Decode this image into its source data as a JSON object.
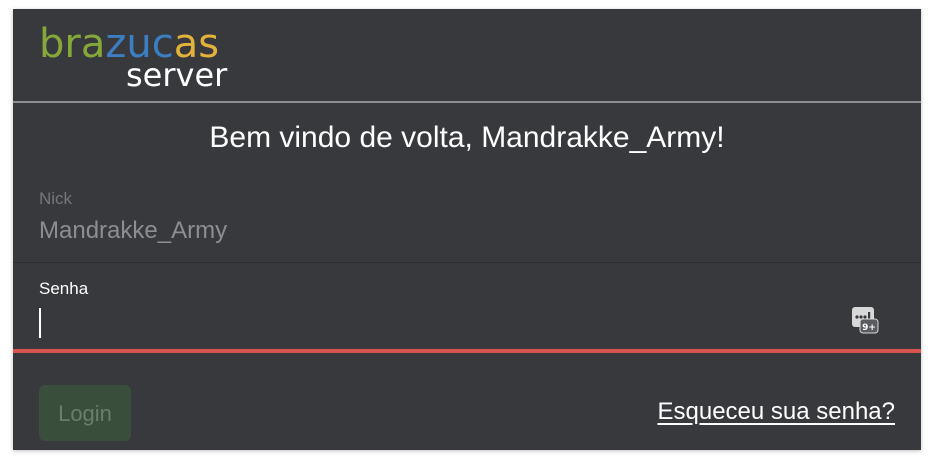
{
  "logo": {
    "brand_part1": "bra",
    "brand_part2": "zuc",
    "brand_part3": "as",
    "subtitle": "server",
    "colors": {
      "green": "#86a83a",
      "blue": "#3b7ec2",
      "yellow": "#e3b23a"
    }
  },
  "welcome": {
    "text": "Bem vindo de volta, Mandrakke_Army!"
  },
  "form": {
    "nick_label": "Nick",
    "nick_value": "Mandrakke_Army",
    "password_label": "Senha",
    "password_value": "",
    "password_icon": "password-manager-icon",
    "error_color": "#d9534f"
  },
  "actions": {
    "login_label": "Login",
    "forgot_label": "Esqueceu sua senha?"
  }
}
